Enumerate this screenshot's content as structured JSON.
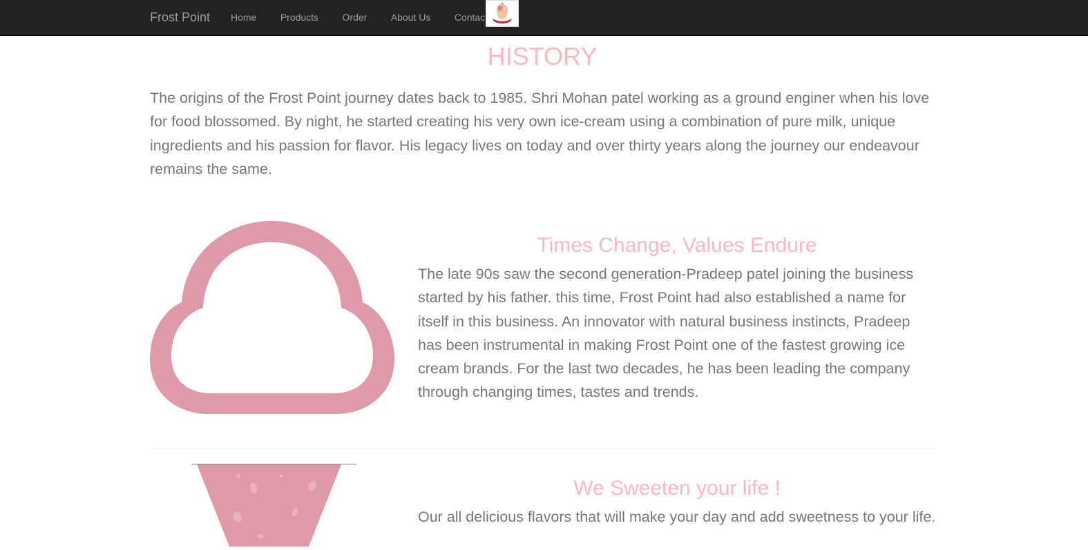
{
  "navbar": {
    "brand": "Frost Point",
    "links": [
      "Home",
      "Products",
      "Order",
      "About Us",
      "Contact"
    ],
    "logo_icon": "ice-cream-logo-icon"
  },
  "history": {
    "title": "HISTORY",
    "paragraph": "The origins of the Frost Point journey dates back to 1985. Shri Mohan patel working as a ground enginer when his love for food blossomed. By night, he started creating his very own ice-cream using a combination of pure milk, unique ingredients and his passion for flavor. His legacy lives on today and over thirty years along the journey our endeavour remains the same."
  },
  "features": [
    {
      "title": "Times Change, Values Endure",
      "text": "The late 90s saw the second generation-Pradeep patel joining the business started by his father. this time, Frost Point had also established a name for itself in this business. An innovator with natural business instincts, Pradeep has been instrumental in making Frost Point one of the fastest growing ice cream brands. For the last two decades, he has been leading the company through changing times, tastes and trends.",
      "icon": "ice-cream-scoop-icon"
    },
    {
      "title": "We Sweeten your life !",
      "text": "Our all delicious flavors that will make your day and add sweetness to your life.",
      "icon": "ice-cream-cone-icon"
    }
  ],
  "colors": {
    "navbar_bg": "#222222",
    "nav_text": "#9d9d9d",
    "heading_pink": "#ffb6c1",
    "body_text": "#777777",
    "icon_pink": "#df9aa8"
  }
}
